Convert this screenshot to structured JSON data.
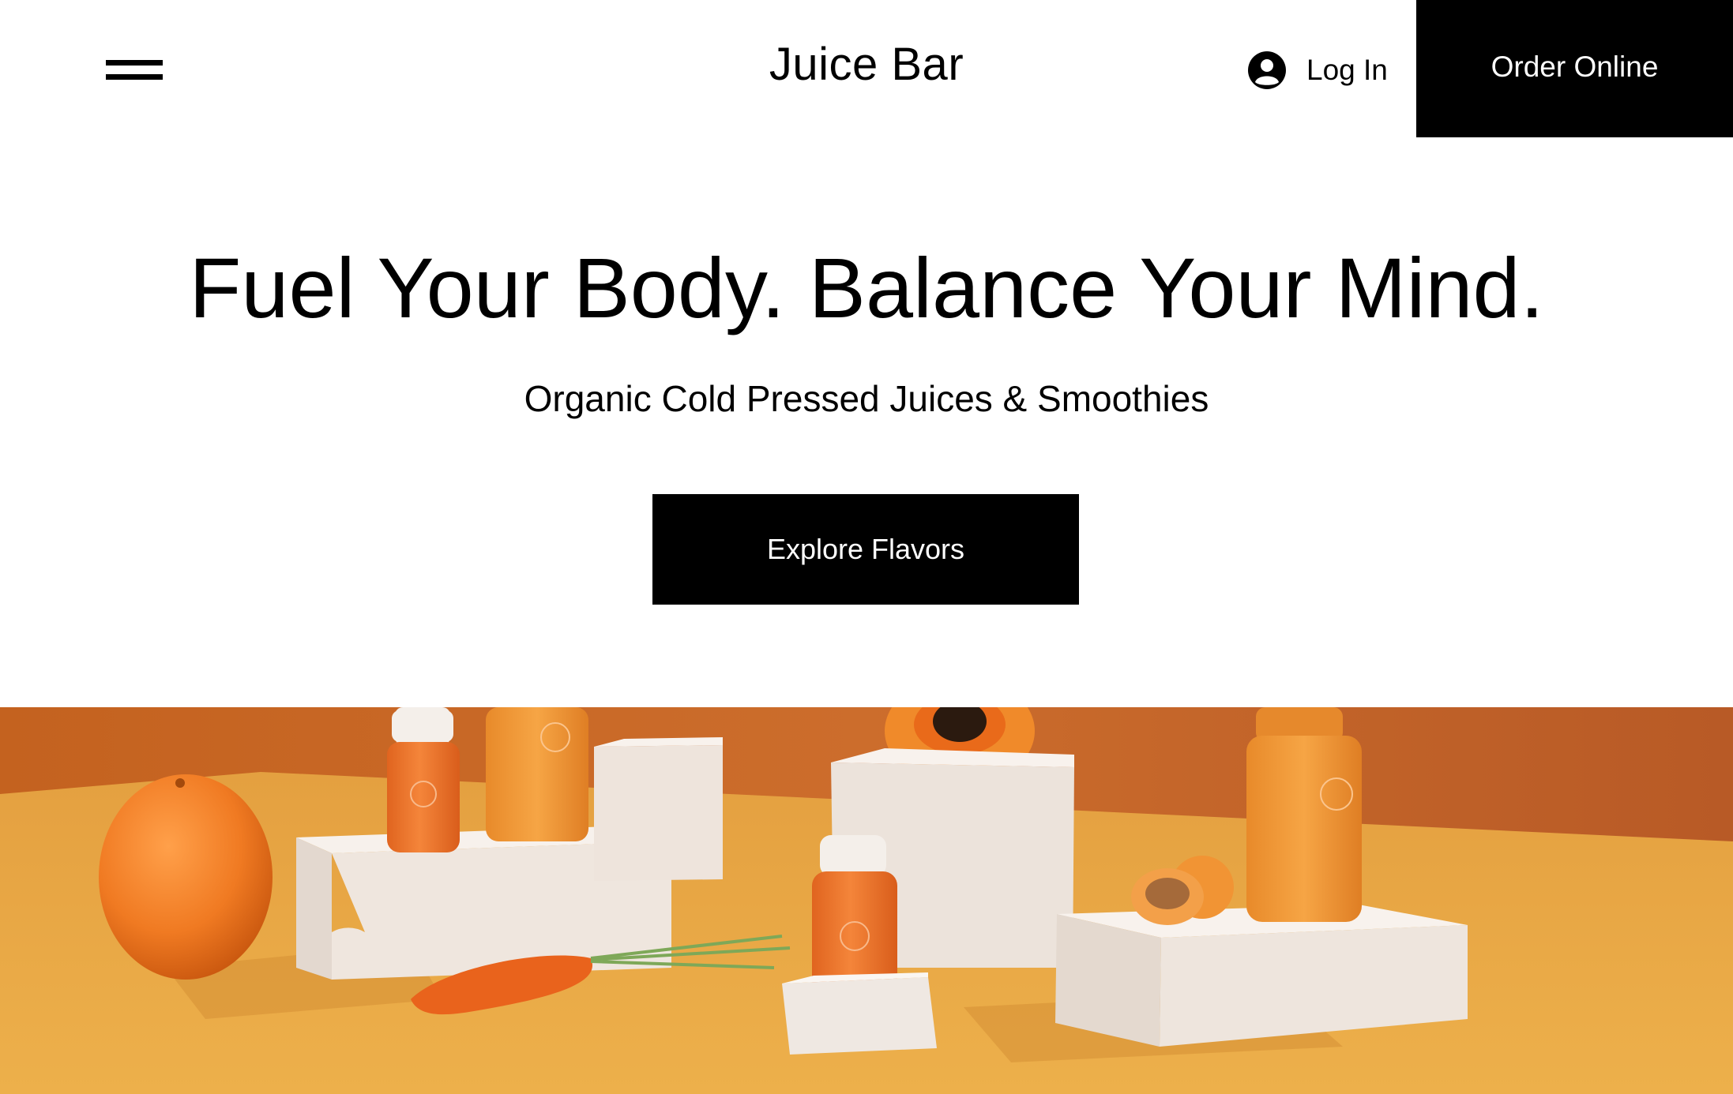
{
  "header": {
    "brand": "Juice Bar",
    "menu_icon": "hamburger-menu-icon",
    "login_icon": "user-avatar-icon",
    "login_label": "Log In",
    "order_label": "Order Online"
  },
  "hero": {
    "title": "Fuel Your Body. Balance Your Mind.",
    "subtitle": "Organic Cold Pressed Juices & Smoothies",
    "cta_label": "Explore Flavors"
  },
  "image": {
    "bottle_brand": "Juice Bar"
  },
  "colors": {
    "button_bg": "#000000",
    "button_text": "#ffffff",
    "image_wall": "#c96a2a",
    "image_table": "#e9a93e",
    "juice": "#ef7a2c",
    "pedestal": "#efe8e2"
  }
}
